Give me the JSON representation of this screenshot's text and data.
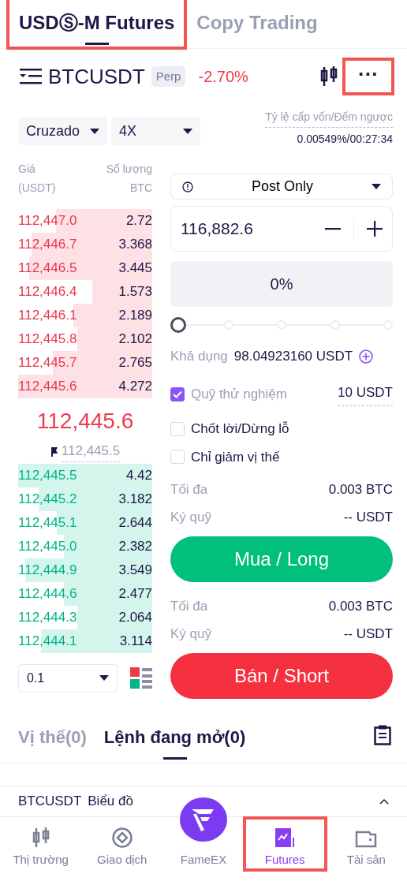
{
  "top_tabs": [
    {
      "label": "USDⓈ-M Futures",
      "selected": true,
      "highlighted": true
    },
    {
      "label": "Copy Trading",
      "selected": false,
      "highlighted": false
    }
  ],
  "header": {
    "symbol": "BTCUSDT",
    "badge": "Perp",
    "change": "-2.70%",
    "more_label": "···",
    "more_highlighted": true
  },
  "margin_mode": "Cruzado",
  "leverage": "4X",
  "funding": {
    "label": "Tỷ lệ cấp vốn/Đếm ngược",
    "value": "0.00549%/00:27:34"
  },
  "order_book": {
    "price_header": "Giá",
    "price_unit": "(USDT)",
    "qty_header": "Số lượng",
    "qty_unit": "BTC",
    "asks": [
      {
        "price": "112,447.0",
        "qty": "2.72"
      },
      {
        "price": "112,446.7",
        "qty": "3.368"
      },
      {
        "price": "112,446.5",
        "qty": "3.445"
      },
      {
        "price": "112,446.4",
        "qty": "1.573"
      },
      {
        "price": "112,446.1",
        "qty": "2.189"
      },
      {
        "price": "112,445.8",
        "qty": "2.102"
      },
      {
        "price": "112,445.7",
        "qty": "2.765"
      },
      {
        "price": "112,445.6",
        "qty": "4.272"
      }
    ],
    "last_price": "112,445.6",
    "mark_price": "112,445.5",
    "bids": [
      {
        "price": "112,445.5",
        "qty": "4.42"
      },
      {
        "price": "112,445.2",
        "qty": "3.182"
      },
      {
        "price": "112,445.1",
        "qty": "2.644"
      },
      {
        "price": "112,445.0",
        "qty": "2.382"
      },
      {
        "price": "112,444.9",
        "qty": "3.549"
      },
      {
        "price": "112,444.6",
        "qty": "2.477"
      },
      {
        "price": "112,444.3",
        "qty": "2.064"
      },
      {
        "price": "112,444.1",
        "qty": "3.114"
      }
    ],
    "precision": "0.1"
  },
  "order_form": {
    "order_type": "Post Only",
    "price": "116,882.6",
    "percent": "0%",
    "slider": {
      "level": 0
    },
    "available_label": "Khả dụng",
    "available": "98.04923160 USDT",
    "options": [
      {
        "label": "Quỹ thử nghiệm",
        "checked": true,
        "value": "10 USDT"
      },
      {
        "label": "Chốt lời/Dừng lỗ",
        "checked": false
      },
      {
        "label": "Chỉ giảm vị thế",
        "checked": false
      }
    ],
    "sides": [
      {
        "kind": "buy",
        "rows": [
          {
            "label": "Tối đa",
            "value": "0.003 BTC"
          },
          {
            "label": "Ký quỹ",
            "value": "-- USDT"
          }
        ],
        "button": "Mua / Long"
      },
      {
        "kind": "sell",
        "rows": [
          {
            "label": "Tối đa",
            "value": "0.003 BTC"
          },
          {
            "label": "Ký quỹ",
            "value": "-- USDT"
          }
        ],
        "button": "Bán / Short"
      }
    ]
  },
  "order_tabs": [
    {
      "label": "Vị thế(0)",
      "selected": false
    },
    {
      "label": "Lệnh đang mở(0)",
      "selected": true
    }
  ],
  "chart_bar": {
    "symbol": "BTCUSDT",
    "label": "Biểu đồ"
  },
  "bottom_nav": [
    {
      "label": "Thị trường",
      "kind": "market",
      "selected": false,
      "highlighted": false
    },
    {
      "label": "Giao dịch",
      "kind": "trade",
      "selected": false,
      "highlighted": false
    },
    {
      "label": "FameEX",
      "kind": "logo",
      "selected": false,
      "highlighted": false
    },
    {
      "label": "Futures",
      "kind": "futures",
      "selected": true,
      "highlighted": true
    },
    {
      "label": "Tài sản",
      "kind": "wallet",
      "selected": false,
      "highlighted": false
    }
  ]
}
